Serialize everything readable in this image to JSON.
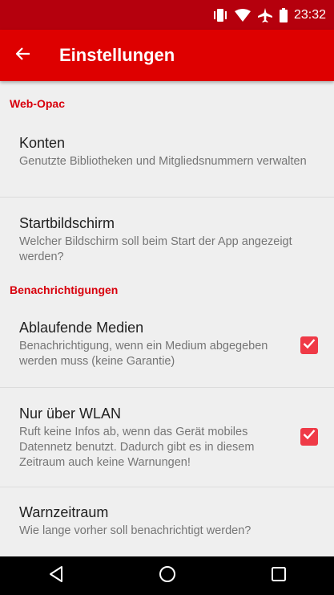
{
  "status_bar": {
    "time": "23:32",
    "icons": [
      "vibrate-icon",
      "wifi-icon",
      "airplane-icon",
      "battery-icon"
    ]
  },
  "app_bar": {
    "title": "Einstellungen",
    "back_icon": "arrow-back-icon"
  },
  "sections": [
    {
      "category": "Web-Opac",
      "items": [
        {
          "title": "Konten",
          "summary": "Genutzte Bibliotheken und Mitgliedsnummern verwalten"
        },
        {
          "title": "Startbildschirm",
          "summary": "Welcher Bildschirm soll beim Start der App angezeigt werden?"
        }
      ]
    },
    {
      "category": "Benachrichtigungen",
      "items": [
        {
          "title": "Ablaufende Medien",
          "summary": "Benachrichtigung, wenn ein Medium abgegeben werden muss (keine Garantie)",
          "checked": true
        },
        {
          "title": "Nur über WLAN",
          "summary": "Ruft keine Infos ab, wenn das Gerät mobiles Datennetz benutzt. Dadurch gibt es in diesem Zeitraum auch keine Warnungen!",
          "checked": true
        },
        {
          "title": "Warnzeitraum",
          "summary": "Wie lange vorher soll benachrichtigt werden?"
        }
      ]
    }
  ],
  "nav_bar": {
    "buttons": [
      "back-triangle-icon",
      "home-circle-icon",
      "recents-square-icon"
    ]
  },
  "colors": {
    "status_bar": "#b5000d",
    "app_bar": "#de0000",
    "accent": "#d8000c",
    "checkbox": "#ef3a47",
    "background": "#efefef"
  }
}
